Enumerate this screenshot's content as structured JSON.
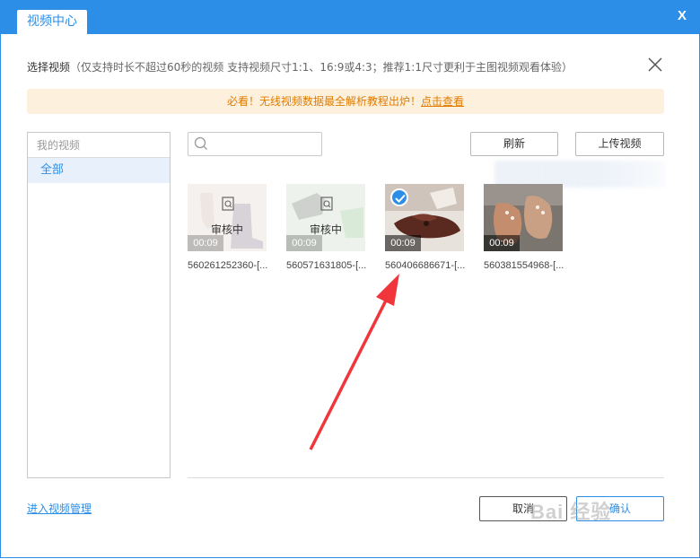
{
  "window": {
    "tab_label": "视频中心",
    "close_label": "X"
  },
  "header": {
    "title": "选择视频",
    "hint": "（仅支持时长不超过60秒的视频 支持视频尺寸1:1、16:9或4:3；推荐1:1尺寸更利于主图视频观看体验）"
  },
  "banner": {
    "text": "必看！无线视频数据最全解析教程出炉！",
    "link": "点击查看"
  },
  "sidebar": {
    "heading": "我的视频",
    "items": [
      {
        "label": "全部",
        "selected": true
      }
    ]
  },
  "toolbar": {
    "search_placeholder": "",
    "refresh_label": "刷新",
    "upload_label": "上传视频"
  },
  "videos": [
    {
      "filename": "560261252360-[...",
      "duration": "00:09",
      "status": "审核中",
      "selected": false
    },
    {
      "filename": "560571631805-[...",
      "duration": "00:09",
      "status": "审核中",
      "selected": false
    },
    {
      "filename": "560406686671-[...",
      "duration": "00:09",
      "status": "",
      "selected": true
    },
    {
      "filename": "560381554968-[...",
      "duration": "00:09",
      "status": "",
      "selected": false
    }
  ],
  "footer": {
    "manage_link": "进入视频管理",
    "cancel_label": "取消",
    "ok_label": "确认"
  },
  "watermark": "Bai 经验",
  "colors": {
    "accent": "#2d8ee8",
    "banner_bg": "#fdf1de",
    "banner_text": "#e07b00",
    "annotation_arrow": "#f0353b"
  }
}
